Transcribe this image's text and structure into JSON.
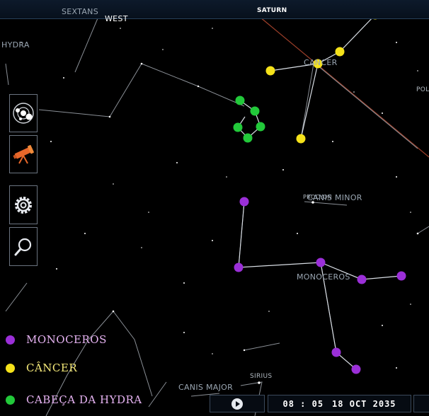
{
  "sky": {
    "labels": {
      "sextans": "SEXTANS",
      "west": "WEST",
      "saturn": "SATURN",
      "hydra": "HYDRA",
      "cancer": "CANCER",
      "pollux": "POLL",
      "procyon": "PROCYON",
      "canis_minor": "CANIS MINOR",
      "monoceros": "MONOCEROS",
      "sirius": "SIRIUS",
      "canis_major": "CANIS MAJOR"
    }
  },
  "toolbar": {
    "items": [
      {
        "icon": "solar-system-icon"
      },
      {
        "icon": "telescope-icon"
      },
      {
        "icon": "gear-icon"
      },
      {
        "icon": "search-icon"
      }
    ]
  },
  "legend": {
    "items": [
      {
        "label": "MONOCEROS",
        "color": "#9b2fd8"
      },
      {
        "label": "CÂNCER",
        "color": "#f5e21a"
      },
      {
        "label": "CABEÇA DA HYDRA",
        "color": "#22c93a"
      }
    ]
  },
  "time_bar": {
    "time": "08 : 05",
    "date": "18 OCT 2035",
    "play_icon": "play-icon"
  }
}
